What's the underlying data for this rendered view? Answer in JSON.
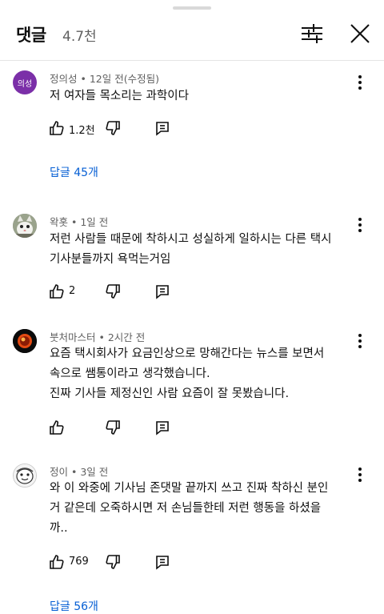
{
  "header": {
    "title": "댓글",
    "count": "4.7천"
  },
  "comments": [
    {
      "avatar_text": "의성",
      "author": "정의성",
      "time": "12일 전(수정됨)",
      "lines": [
        "저 여자들 목소리는 과학이다"
      ],
      "likes": "1.2천",
      "replies": "답글 45개"
    },
    {
      "avatar_icon": "cat-avatar-icon",
      "author": "왁홋",
      "time": "1일 전",
      "lines": [
        "저런 사람들 때문에 착하시고 성실하게 일하시는 다른 택시",
        "기사분들까지 욕먹는거임"
      ],
      "likes": "2"
    },
    {
      "avatar_icon": "dark-orb-avatar-icon",
      "author": "붓처마스터",
      "time": "2시간 전",
      "lines": [
        "요즘 택시회사가 요금인상으로 망해간다는 뉴스를 보면서",
        "속으로 쌤통이라고 생각했습니다.",
        "진짜 기사들 제정신인 사람 요즘이 잘 못봤습니다."
      ]
    },
    {
      "avatar_icon": "cartoon-face-avatar-icon",
      "author": "정이",
      "time": "3일 전",
      "lines": [
        "와 이 와중에 기사님 존댓말 끝까지 쓰고 진짜 착하신 분인",
        "거 같은데 오죽하시면 저 손님들한테 저런 행동을 하셨을",
        "까.."
      ],
      "likes": "769",
      "replies": "답글 56개"
    }
  ],
  "colors": {
    "link": "#065fd4",
    "meta": "#606060",
    "avatar_bg": "#7b2fa8"
  },
  "icons": {
    "like": "thumbs-up-icon",
    "dislike": "thumbs-down-icon",
    "reply": "reply-icon",
    "more": "more-vertical-icon",
    "filter": "sliders-icon",
    "close": "close-icon"
  }
}
